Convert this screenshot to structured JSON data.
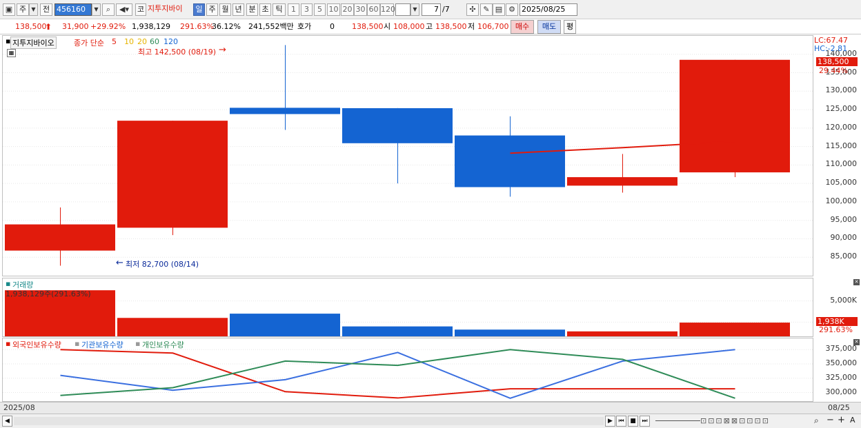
{
  "toolbar": {
    "period_type": "주",
    "prev_label": "전",
    "code": "456160",
    "stock_name": "지투지바이",
    "periods": [
      "일",
      "주",
      "월",
      "년",
      "분",
      "초",
      "틱"
    ],
    "selected_period": "일",
    "intervals": [
      "1",
      "3",
      "5",
      "10",
      "20",
      "30",
      "60",
      "120"
    ],
    "page": "7",
    "page_total": "/7",
    "date": "2025/08/25",
    "icons": [
      "window-icon",
      "search-icon",
      "speaker-icon",
      "crosshair-icon",
      "drawing-icon",
      "save-icon",
      "gear-icon"
    ]
  },
  "quote": {
    "price": "138,500",
    "change": "31,900",
    "change_pct": "+29.92%",
    "volume": "1,938,129",
    "volume_ratio": "291.63%",
    "turnover": "36.12%",
    "amount": "241,552백만",
    "bid_label": "호가",
    "bid_value": "0",
    "bid_price": "138,500",
    "open_label": "시",
    "open": "108,000",
    "high_label": "고",
    "high": "138,500",
    "low_label": "저",
    "low": "106,700",
    "buy_label": "매수",
    "sell_label": "매도",
    "avg_label": "평"
  },
  "colors": {
    "up": "#e11b0c",
    "down": "#1464d2",
    "ma5": "#e11b0c",
    "ma10": "#e6b400",
    "ma20": "#e6b400",
    "ma60": "#2e8b57",
    "ma120": "#1464d2"
  },
  "price_panel": {
    "name": "지투지바이오",
    "legend_prefix": "종가 단순",
    "ma_periods": [
      "5",
      "10",
      "20",
      "60",
      "120"
    ],
    "high_note": "최고 142,500 (08/19)",
    "low_note": "최저 82,700 (08/14)",
    "lc": "LC:67.47",
    "hc": "HC:-2.81",
    "current_tag": "138,500",
    "current_pct": "29.44%",
    "ticks": [
      "140,000",
      "135,000",
      "130,000",
      "125,000",
      "120,000",
      "115,000",
      "110,000",
      "105,000",
      "100,000",
      "95,000",
      "90,000",
      "85,000"
    ]
  },
  "volume_panel": {
    "title": "거래량",
    "info": "1,938,129주(291.63%)",
    "ticks": [
      "5,000K",
      "2,500K"
    ],
    "current_tag": "1,938K",
    "current_pct": "291.63%"
  },
  "holdings_panel": {
    "legends": [
      "외국인보유수량",
      "기관보유수량",
      "개인보유수량"
    ],
    "ticks": [
      "375,000",
      "350,000",
      "325,000",
      "300,000"
    ]
  },
  "status": {
    "left_date": "2025/08",
    "right_date": "08/25"
  },
  "chart_data": [
    {
      "type": "candlestick",
      "title": "지투지바이오",
      "candles": [
        {
          "open": 93900,
          "high": 98500,
          "low": 82700,
          "close": 86800,
          "dir": "up"
        },
        {
          "open": 93000,
          "high": 122000,
          "low": 91000,
          "close": 122000,
          "dir": "up"
        },
        {
          "open": 125500,
          "high": 142500,
          "low": 119500,
          "close": 123800,
          "dir": "down"
        },
        {
          "open": 125400,
          "high": 125400,
          "low": 105000,
          "close": 115900,
          "dir": "down"
        },
        {
          "open": 118000,
          "high": 123200,
          "low": 101400,
          "close": 104000,
          "dir": "down"
        },
        {
          "open": 104400,
          "high": 113000,
          "low": 102500,
          "close": 106700,
          "dir": "up"
        },
        {
          "open": 108000,
          "high": 138500,
          "low": 106700,
          "close": 138500,
          "dir": "up"
        }
      ],
      "ma5": [
        null,
        null,
        null,
        null,
        113200,
        114700,
        116400
      ],
      "ylim": [
        80000,
        145000
      ]
    },
    {
      "type": "bar",
      "title": "거래량",
      "values": [
        6500,
        2600,
        3200,
        1400,
        950,
        700,
        1938
      ],
      "dirs": [
        "up",
        "up",
        "down",
        "down",
        "down",
        "up",
        "up"
      ],
      "ylim": [
        0,
        7000
      ]
    },
    {
      "type": "line",
      "series": [
        {
          "name": "외국인보유수량",
          "values": [
            375000,
            369000,
            301500,
            290500,
            306500,
            306500,
            306500
          ]
        },
        {
          "name": "기관보유수량",
          "values": [
            330000,
            304000,
            322500,
            370000,
            290000,
            355000,
            375000
          ]
        },
        {
          "name": "개인보유수량",
          "values": [
            295000,
            308500,
            355000,
            347500,
            375000,
            358000,
            290000
          ]
        }
      ],
      "ylim": [
        285000,
        385000
      ]
    }
  ]
}
